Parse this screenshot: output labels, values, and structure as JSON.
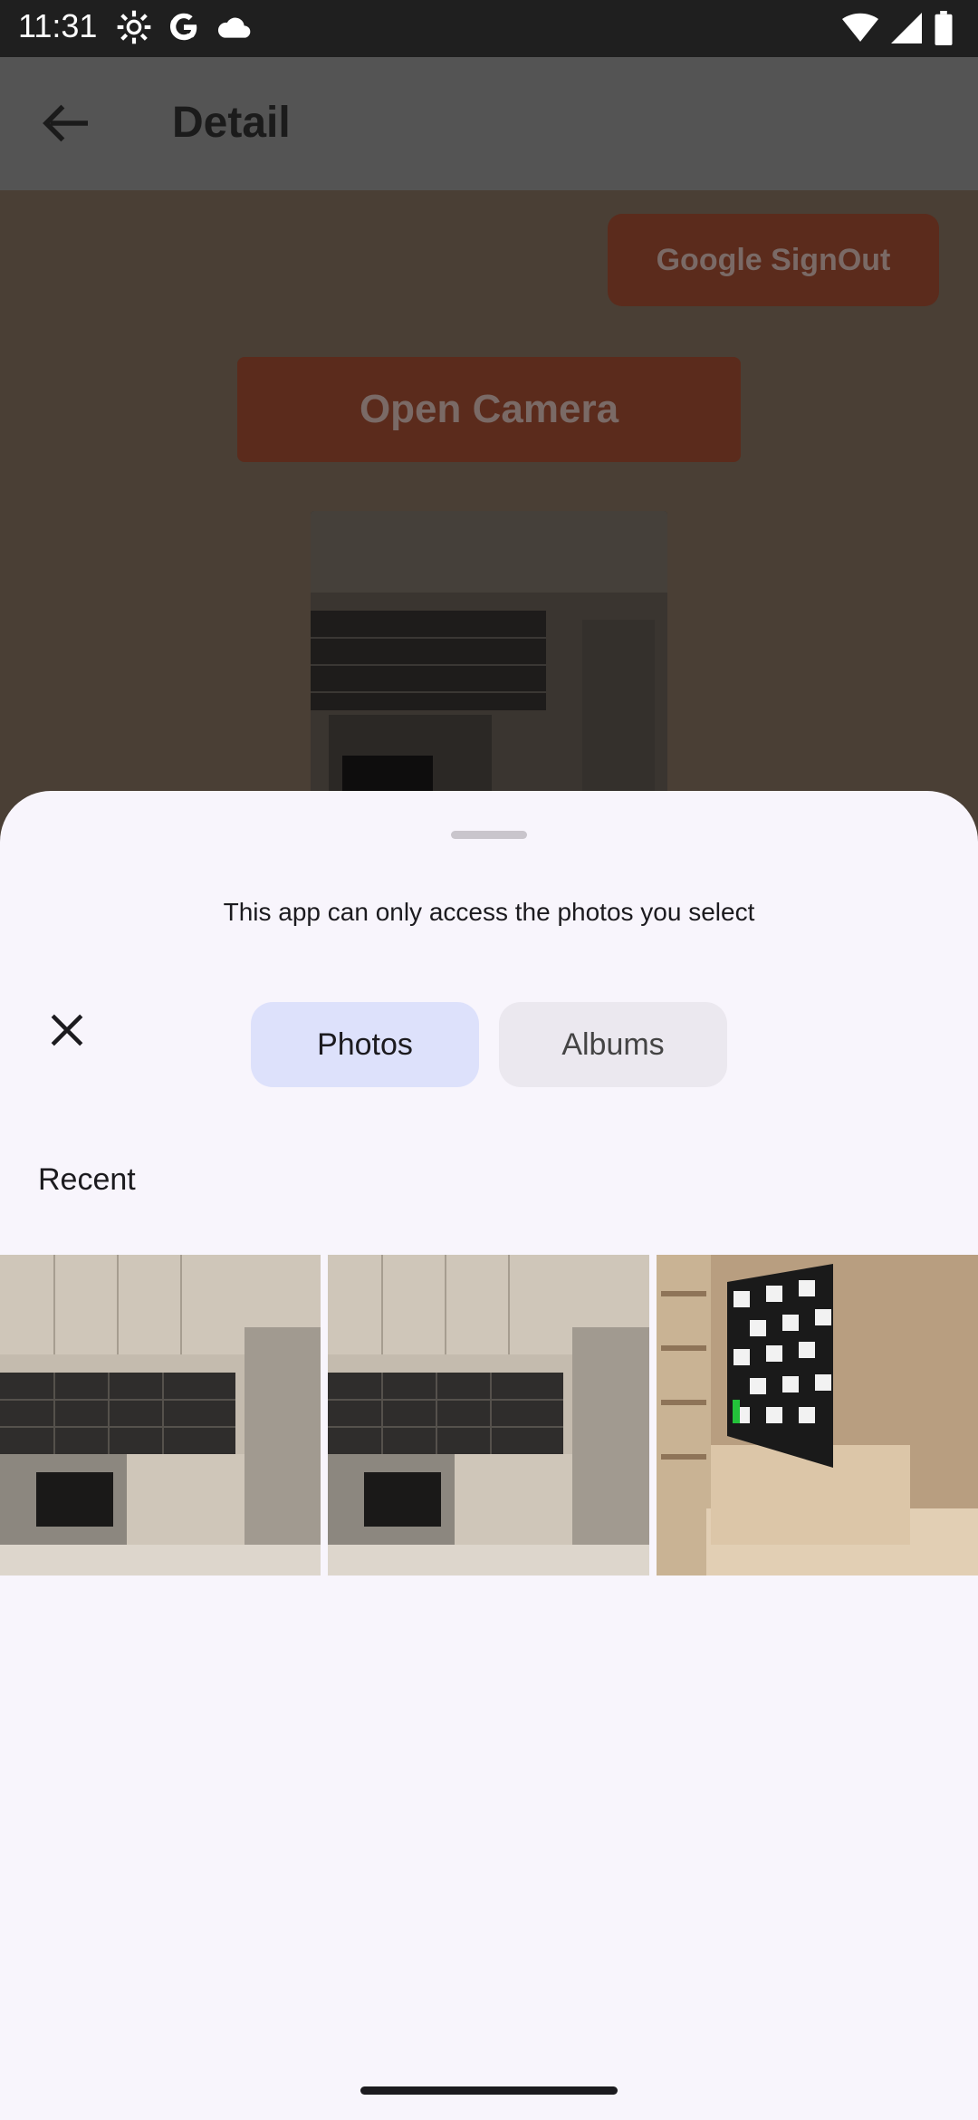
{
  "status_bar": {
    "time": "11:31",
    "icons": [
      "settings-icon",
      "google-icon",
      "cloud-icon",
      "wifi-icon",
      "signal-icon",
      "battery-icon"
    ]
  },
  "app": {
    "title": "Detail",
    "signout_label": "Google SignOut",
    "camera_label": "Open Camera"
  },
  "picker": {
    "message": "This app can only access the photos you select",
    "tabs": [
      {
        "label": "Photos",
        "selected": true
      },
      {
        "label": "Albums",
        "selected": false
      }
    ],
    "section": "Recent",
    "photos": [
      {
        "subject": "kitchen"
      },
      {
        "subject": "kitchen"
      },
      {
        "subject": "tv-room"
      }
    ]
  },
  "colors": {
    "sheet_bg": "#f8f5fc",
    "tab_selected_bg": "#dde1fb",
    "tab_unselected_bg": "#ebe8ef",
    "button_dimmed": "#5b2b1c"
  }
}
